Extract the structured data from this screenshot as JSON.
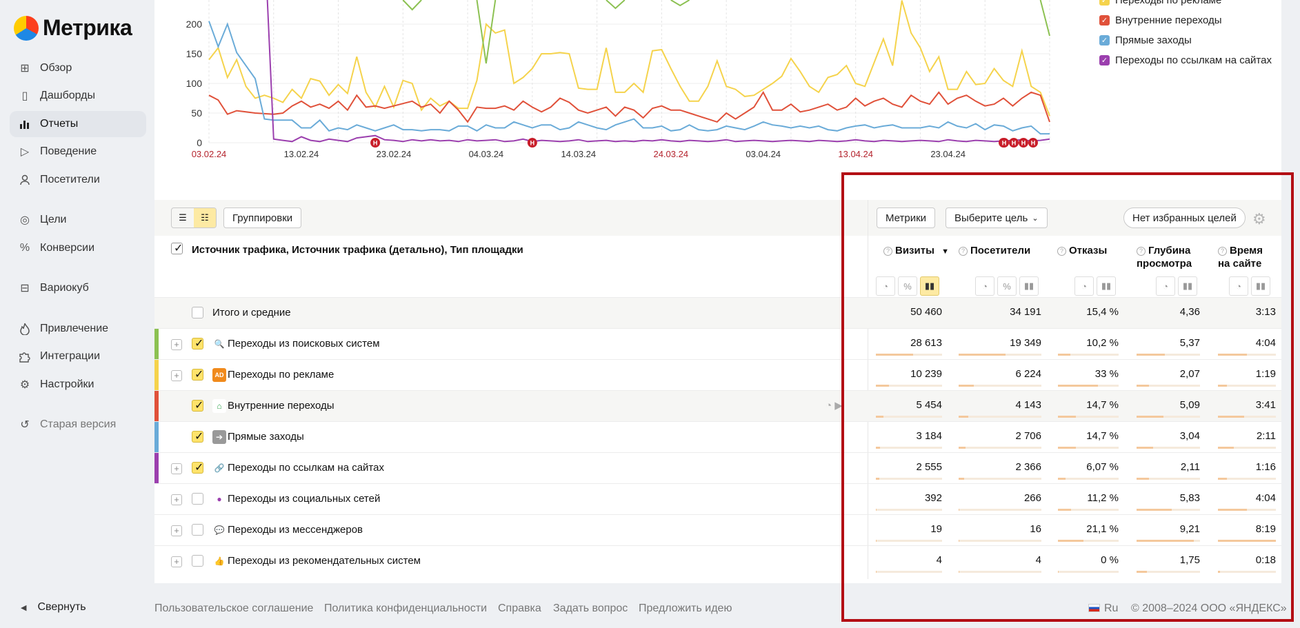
{
  "brand": {
    "name": "Метрика"
  },
  "sidebar": {
    "items": [
      {
        "label": "Обзор",
        "icon": "grid-icon"
      },
      {
        "label": "Дашборды",
        "icon": "dashboard-icon"
      },
      {
        "label": "Отчеты",
        "icon": "bar-chart-icon",
        "active": true
      },
      {
        "label": "Поведение",
        "icon": "play-icon"
      },
      {
        "label": "Посетители",
        "icon": "person-icon"
      },
      {
        "label": "Цели",
        "icon": "target-icon"
      },
      {
        "label": "Конверсии",
        "icon": "percent-icon"
      },
      {
        "label": "Вариокуб",
        "icon": "cube-icon"
      },
      {
        "label": "Привлечение",
        "icon": "flame-icon"
      },
      {
        "label": "Интеграции",
        "icon": "puzzle-icon"
      },
      {
        "label": "Настройки",
        "icon": "gear-icon"
      },
      {
        "label": "Старая версия",
        "icon": "undo-icon"
      }
    ],
    "collapse_label": "Свернуть"
  },
  "chart_data": {
    "type": "line",
    "x_ticks": [
      "03.02.24",
      "13.02.24",
      "23.02.24",
      "04.03.24",
      "14.03.24",
      "24.03.24",
      "03.04.24",
      "13.04.24",
      "23.04.24"
    ],
    "weekend_ticks": [
      "03.02.24",
      "24.03.24",
      "13.04.24"
    ],
    "y_ticks": [
      0,
      50,
      100,
      150,
      200
    ],
    "ylim": [
      0,
      240
    ],
    "x_count": 92,
    "series": [
      {
        "name": "Переходы по рекламе",
        "color": "#f5d34c",
        "values": [
          140,
          160,
          110,
          140,
          95,
          75,
          80,
          75,
          68,
          90,
          75,
          108,
          104,
          80,
          98,
          83,
          145,
          85,
          60,
          95,
          60,
          105,
          100,
          55,
          75,
          62,
          70,
          58,
          58,
          105,
          200,
          185,
          190,
          100,
          110,
          125,
          150,
          150,
          152,
          150,
          92,
          90,
          90,
          160,
          85,
          85,
          100,
          85,
          155,
          157,
          125,
          95,
          70,
          70,
          95,
          138,
          95,
          90,
          78,
          80,
          90,
          100,
          112,
          142,
          120,
          95,
          85,
          110,
          115,
          130,
          100,
          95,
          135,
          175,
          130,
          240,
          185,
          160,
          120,
          145,
          90,
          90,
          120,
          98,
          100,
          125,
          105,
          95,
          155,
          95,
          85,
          45
        ]
      },
      {
        "name": "Внутренние переходы",
        "color": "#e0513a",
        "values": [
          80,
          72,
          48,
          54,
          52,
          50,
          49,
          48,
          50,
          62,
          70,
          60,
          65,
          58,
          70,
          55,
          80,
          60,
          62,
          58,
          62,
          66,
          70,
          60,
          65,
          50,
          70,
          55,
          35,
          60,
          58,
          58,
          62,
          55,
          70,
          60,
          52,
          60,
          75,
          68,
          55,
          50,
          55,
          60,
          45,
          60,
          55,
          42,
          58,
          62,
          55,
          55,
          50,
          45,
          40,
          35,
          50,
          40,
          50,
          60,
          85,
          55,
          55,
          65,
          52,
          55,
          60,
          65,
          55,
          60,
          75,
          62,
          70,
          75,
          65,
          60,
          80,
          70,
          65,
          85,
          65,
          75,
          80,
          70,
          62,
          65,
          75,
          62,
          75,
          85,
          80,
          35
        ]
      },
      {
        "name": "Прямые заходы",
        "color": "#6aabd8",
        "values": [
          205,
          162,
          200,
          152,
          130,
          108,
          40,
          38,
          38,
          38,
          25,
          25,
          38,
          20,
          25,
          22,
          30,
          25,
          20,
          25,
          30,
          22,
          22,
          20,
          22,
          22,
          20,
          28,
          28,
          20,
          30,
          25,
          25,
          35,
          30,
          25,
          30,
          30,
          22,
          25,
          35,
          30,
          25,
          22,
          30,
          35,
          40,
          25,
          25,
          28,
          20,
          22,
          30,
          22,
          20,
          22,
          28,
          25,
          22,
          28,
          35,
          30,
          28,
          25,
          28,
          25,
          28,
          22,
          20,
          25,
          28,
          30,
          25,
          28,
          30,
          25,
          25,
          25,
          28,
          25,
          35,
          28,
          25,
          32,
          22,
          30,
          28,
          20,
          25,
          28,
          15,
          15
        ]
      },
      {
        "name": "Переходы по ссылкам на сайтах",
        "color": "#9b3fae",
        "values": [
          null,
          null,
          null,
          null,
          null,
          null,
          350,
          6,
          4,
          2,
          10,
          4,
          2,
          6,
          4,
          2,
          8,
          10,
          12,
          5,
          4,
          2,
          5,
          3,
          5,
          3,
          4,
          2,
          5,
          3,
          4,
          5,
          2,
          3,
          6,
          2,
          4,
          3,
          2,
          3,
          5,
          2,
          3,
          4,
          2,
          3,
          2,
          4,
          3,
          5,
          3,
          2,
          4,
          3,
          2,
          3,
          5,
          2,
          3,
          4,
          3,
          2,
          3,
          4,
          3,
          2,
          4,
          3,
          2,
          3,
          5,
          3,
          2,
          4,
          3,
          2,
          3,
          4,
          3,
          2,
          5,
          3,
          2,
          4,
          3,
          2,
          3,
          4,
          5,
          3,
          4,
          6
        ]
      },
      {
        "name": "Переходы из поисковых систем",
        "color": "#8cc152",
        "values": [
          null,
          null,
          null,
          null,
          null,
          null,
          null,
          null,
          null,
          null,
          null,
          null,
          null,
          null,
          null,
          null,
          null,
          null,
          null,
          null,
          null,
          null,
          null,
          null,
          null,
          null,
          null,
          null,
          null,
          null,
          null,
          null,
          null,
          null,
          null,
          null,
          null,
          null,
          null,
          null,
          null,
          null,
          null,
          null,
          null,
          null,
          null,
          null,
          null,
          null,
          null,
          null,
          null,
          null,
          null,
          null,
          null,
          null,
          null,
          null,
          null,
          null,
          null,
          null,
          null,
          null,
          null,
          null,
          null,
          null,
          null,
          null,
          null,
          null,
          null,
          null,
          null,
          null,
          null,
          null,
          null,
          null,
          null,
          null,
          null,
          null,
          null,
          null,
          null,
          null,
          null,
          null
        ]
      }
    ],
    "holiday_markers": [
      "Н",
      "Н",
      "Н",
      "Н",
      "Н",
      "Н",
      "Н"
    ]
  },
  "legend": [
    {
      "label": "Переходы по рекламе",
      "color": "#f5d34c"
    },
    {
      "label": "Внутренние переходы",
      "color": "#e0513a"
    },
    {
      "label": "Прямые заходы",
      "color": "#6aabd8"
    },
    {
      "label": "Переходы по ссылкам на сайтах",
      "color": "#9b3fae"
    }
  ],
  "toolbar": {
    "groupings_label": "Группировки",
    "metrics_label": "Метрики",
    "goal_select_label": "Выберите цель",
    "favorites_label": "Нет избранных целей"
  },
  "table": {
    "dimension_header": "Источник трафика, Источник трафика (детально), Тип площадки",
    "metric_headers": [
      {
        "label": "Визиты",
        "sort": "▼"
      },
      {
        "label": "Посетители"
      },
      {
        "label": "Отказы"
      },
      {
        "label": "Глубина просмотра"
      },
      {
        "label": "Время на сайте"
      }
    ],
    "total_row": {
      "label": "Итого и средние",
      "values": [
        "50 460",
        "34 191",
        "15,4 %",
        "4,36",
        "3:13"
      ]
    },
    "rows": [
      {
        "label": "Переходы из поисковых систем",
        "color": "#8cc152",
        "checked": true,
        "expandable": true,
        "icon": "search-source-icon",
        "values": [
          "28 613",
          "19 349",
          "10,2 %",
          "5,37",
          "4:04"
        ],
        "bars": [
          0.56,
          0.57,
          0.2,
          0.45,
          0.5
        ]
      },
      {
        "label": "Переходы по рекламе",
        "color": "#f5d34c",
        "checked": true,
        "expandable": true,
        "icon": "ad-icon",
        "values": [
          "10 239",
          "6 224",
          "33 %",
          "2,07",
          "1:19"
        ],
        "bars": [
          0.2,
          0.18,
          0.66,
          0.2,
          0.16
        ]
      },
      {
        "label": "Внутренние переходы",
        "color": "#e0513a",
        "checked": true,
        "expandable": false,
        "icon": "home-icon",
        "values": [
          "5 454",
          "4 143",
          "14,7 %",
          "5,09",
          "3:41"
        ],
        "bars": [
          0.11,
          0.12,
          0.29,
          0.42,
          0.45
        ]
      },
      {
        "label": "Прямые заходы",
        "color": "#6aabd8",
        "checked": true,
        "expandable": false,
        "icon": "direct-icon",
        "values": [
          "3 184",
          "2 706",
          "14,7 %",
          "3,04",
          "2:11"
        ],
        "bars": [
          0.06,
          0.08,
          0.29,
          0.26,
          0.27
        ]
      },
      {
        "label": "Переходы по ссылкам на сайтах",
        "color": "#9b3fae",
        "checked": true,
        "expandable": true,
        "icon": "link-icon",
        "values": [
          "2 555",
          "2 366",
          "6,07 %",
          "2,11",
          "1:16"
        ],
        "bars": [
          0.05,
          0.07,
          0.12,
          0.2,
          0.15
        ]
      },
      {
        "label": "Переходы из социальных сетей",
        "color": "",
        "checked": false,
        "expandable": true,
        "icon": "social-icon",
        "values": [
          "392",
          "266",
          "11,2 %",
          "5,83",
          "4:04"
        ],
        "bars": [
          0.01,
          0.01,
          0.22,
          0.55,
          0.5
        ]
      },
      {
        "label": "Переходы из мессенджеров",
        "color": "",
        "checked": false,
        "expandable": true,
        "icon": "messenger-icon",
        "values": [
          "19",
          "16",
          "21,1 %",
          "9,21",
          "8:19"
        ],
        "bars": [
          0.002,
          0.002,
          0.42,
          0.9,
          1.0
        ]
      },
      {
        "label": "Переходы из рекомендательных систем",
        "color": "",
        "checked": false,
        "expandable": true,
        "icon": "thumbs-up-icon",
        "values": [
          "4",
          "4",
          "0 %",
          "1,75",
          "0:18"
        ],
        "bars": [
          0.001,
          0.001,
          0,
          0.16,
          0.04
        ]
      }
    ]
  },
  "footer": {
    "links": [
      "Пользовательское соглашение",
      "Политика конфиденциальности",
      "Справка",
      "Задать вопрос",
      "Предложить идею"
    ],
    "language": "Ru",
    "copyright": "© 2008–2024 ООО «ЯНДЕКС»"
  }
}
